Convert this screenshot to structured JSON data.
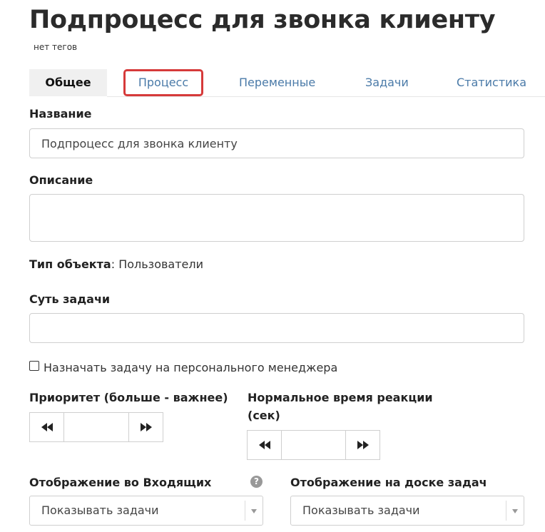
{
  "page": {
    "title": "Подпроцесс для звонка клиенту",
    "tags": "нет тегов"
  },
  "tabs": [
    {
      "label": "Общее",
      "state": "active"
    },
    {
      "label": "Процесс",
      "state": "highlighted"
    },
    {
      "label": "Переменные"
    },
    {
      "label": "Задачи"
    },
    {
      "label": "Статистика"
    }
  ],
  "form": {
    "name_label": "Название",
    "name_value": "Подпроцесс для звонка клиенту",
    "description_label": "Описание",
    "description_value": "",
    "object_type_label": "Тип объекта",
    "object_type_sep": ":",
    "object_type_value": "Пользователи",
    "task_essence_label": "Суть задачи",
    "task_essence_value": "",
    "assign_checkbox_label": "Назначать задачу на персонального менеджера",
    "assign_checkbox_checked": false,
    "priority_label": "Приоритет (больше - важнее)",
    "priority_value": "",
    "reaction_label_line1": "Нормальное время реакции",
    "reaction_label_line2": "(сек)",
    "reaction_value": "",
    "inbox_display_label": "Отображение во Входящих",
    "inbox_display_value": "Показывать задачи",
    "board_display_label": "Отображение на доске задач",
    "board_display_value": "Показывать задачи"
  },
  "icons": {
    "decrement": "rewind-icon",
    "increment": "fast-forward-icon",
    "help": "question-icon",
    "dropdown": "caret-down-icon"
  },
  "colors": {
    "tab_link": "#4a7aa8",
    "highlight": "#d63a3a",
    "active_tab_bg": "#f0f0f0"
  }
}
